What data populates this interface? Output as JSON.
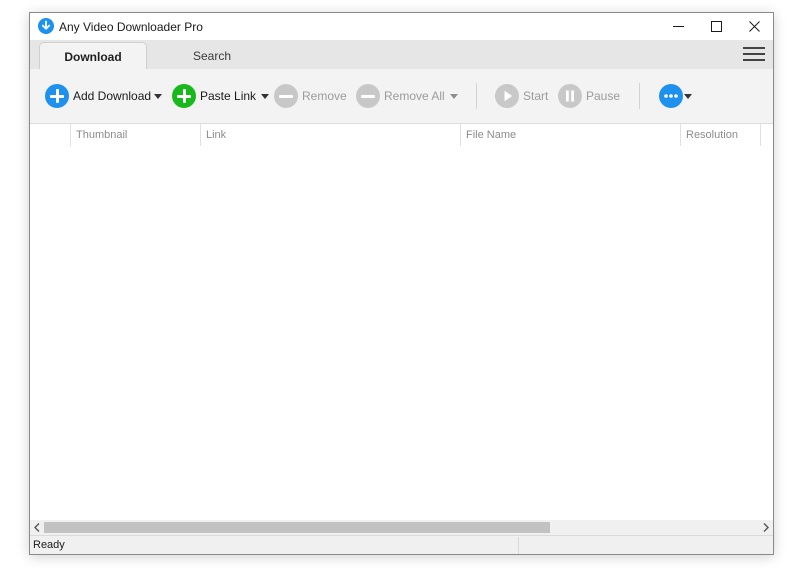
{
  "window": {
    "title": "Any Video Downloader Pro",
    "app_icon": "download-arrow-icon",
    "controls": {
      "minimize": "minimize-icon",
      "maximize": "maximize-icon",
      "close": "close-icon"
    }
  },
  "tabs": [
    {
      "label": "Download",
      "active": true
    },
    {
      "label": "Search",
      "active": false
    }
  ],
  "menu_icon": "hamburger-menu-icon",
  "toolbar": {
    "add_download": {
      "label": "Add Download",
      "icon": "plus-circle-icon",
      "color": "#1e90ee",
      "enabled": true
    },
    "paste_link": {
      "label": "Paste Link",
      "icon": "plus-circle-icon",
      "color": "#19b81d",
      "enabled": true
    },
    "remove": {
      "label": "Remove",
      "icon": "minus-circle-icon",
      "enabled": false
    },
    "remove_all": {
      "label": "Remove All",
      "icon": "minus-circle-icon",
      "enabled": false
    },
    "start": {
      "label": "Start",
      "icon": "play-circle-icon",
      "enabled": false
    },
    "pause": {
      "label": "Pause",
      "icon": "pause-circle-icon",
      "enabled": false
    },
    "more": {
      "icon": "more-dots-icon",
      "color": "#1e90ee"
    }
  },
  "table": {
    "columns": [
      "Thumbnail",
      "Link",
      "File Name",
      "Resolution"
    ],
    "rows": []
  },
  "status": {
    "text": "Ready"
  },
  "colors": {
    "accent": "#1e90ee",
    "green": "#19b81d",
    "disabled": "#c8c8c8"
  }
}
